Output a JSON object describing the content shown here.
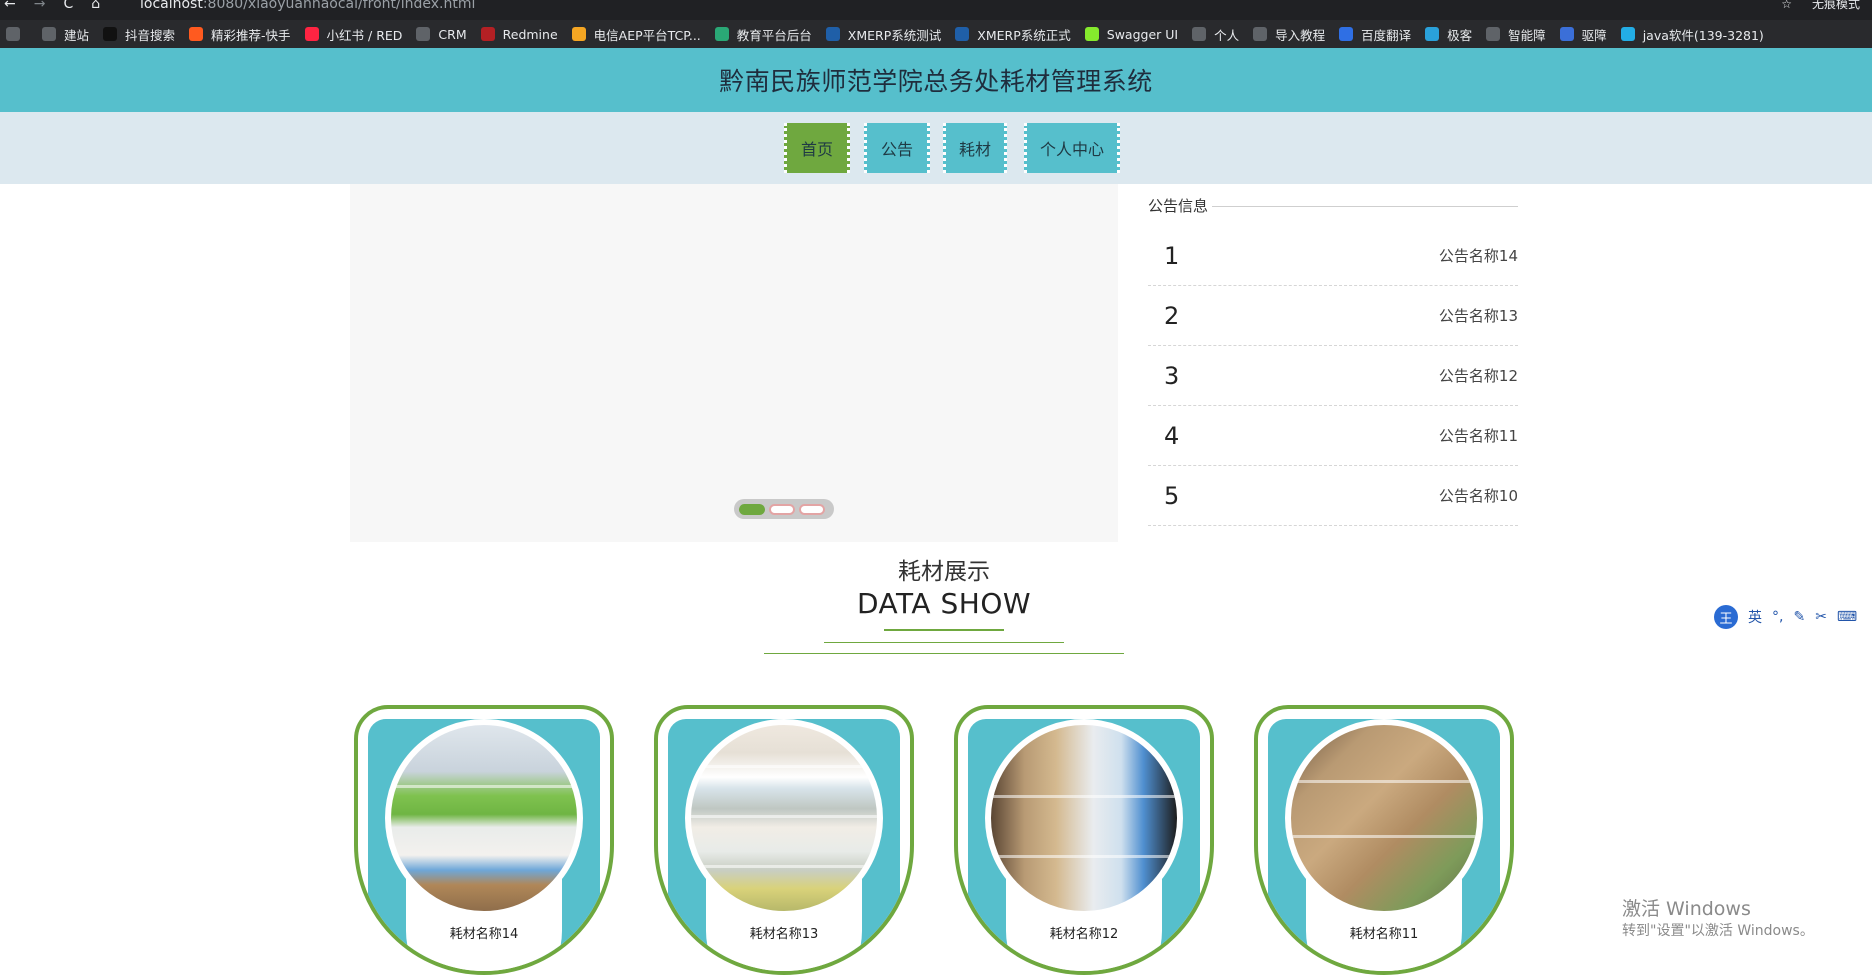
{
  "browser": {
    "url_host": "localhost",
    "url_rest": ":8080/xiaoyuanhaocai/front/index.html",
    "nav_back": "←",
    "nav_forward": "→",
    "nav_reload": "C",
    "nav_home": "⌂",
    "star": "☆",
    "incognito_label": "无痕模式",
    "bookmarks": [
      {
        "label": "",
        "icon": "grid-icon",
        "color": "#5f6368"
      },
      {
        "label": "建站",
        "icon": "chrome-icon",
        "color": "#5f6368"
      },
      {
        "label": "抖音搜索",
        "icon": "tiktok-icon",
        "color": "#111111"
      },
      {
        "label": "精彩推荐-快手",
        "icon": "kuaishou-icon",
        "color": "#ff5a1f"
      },
      {
        "label": "小红书 / RED",
        "icon": "red-icon",
        "color": "#ff2442"
      },
      {
        "label": "CRM",
        "icon": "globe-icon",
        "color": "#5f6368"
      },
      {
        "label": "Redmine",
        "icon": "redmine-icon",
        "color": "#b32024"
      },
      {
        "label": "电信AEP平台TCP...",
        "icon": "aep-icon",
        "color": "#f5a623"
      },
      {
        "label": "教育平台后台",
        "icon": "edu-icon",
        "color": "#2aa876"
      },
      {
        "label": "XMERP系统测试",
        "icon": "xmerp-icon",
        "color": "#1f5fa8"
      },
      {
        "label": "XMERP系统正式",
        "icon": "xmerp-icon",
        "color": "#1f5fa8"
      },
      {
        "label": "Swagger UI",
        "icon": "swagger-icon",
        "color": "#85ea2d"
      },
      {
        "label": "个人",
        "icon": "globe-icon",
        "color": "#5f6368"
      },
      {
        "label": "导入教程",
        "icon": "globe-icon",
        "color": "#5f6368"
      },
      {
        "label": "百度翻译",
        "icon": "translate-icon",
        "color": "#2f6fe4"
      },
      {
        "label": "极客",
        "icon": "telegram-icon",
        "color": "#2aa1da"
      },
      {
        "label": "智能障",
        "icon": "globe-icon",
        "color": "#5f6368"
      },
      {
        "label": "驱障",
        "icon": "shield-icon",
        "color": "#3b6fd8"
      },
      {
        "label": "java软件(139-3281)",
        "icon": "bilibili-icon",
        "color": "#23ade5"
      }
    ]
  },
  "site": {
    "title": "黔南民族师范学院总务处耗材管理系统",
    "nav": [
      {
        "label": "首页",
        "active": true
      },
      {
        "label": "公告",
        "active": false
      },
      {
        "label": "耗材",
        "active": false
      },
      {
        "label": "个人中心",
        "active": false
      }
    ]
  },
  "notice": {
    "heading": "公告信息",
    "items": [
      {
        "num": "1",
        "name": "公告名称14"
      },
      {
        "num": "2",
        "name": "公告名称13"
      },
      {
        "num": "3",
        "name": "公告名称12"
      },
      {
        "num": "4",
        "name": "公告名称11"
      },
      {
        "num": "5",
        "name": "公告名称10"
      }
    ]
  },
  "carousel": {
    "active_index": 0,
    "count": 3
  },
  "section": {
    "title_cn": "耗材展示",
    "title_en": "DATA SHOW"
  },
  "products": [
    {
      "name": "耗材名称14"
    },
    {
      "name": "耗材名称13"
    },
    {
      "name": "耗材名称12"
    },
    {
      "name": "耗材名称11"
    }
  ],
  "ime": {
    "lang": "英",
    "logo": "王"
  },
  "watermark": {
    "line1": "激活 Windows",
    "line2": "转到\"设置\"以激活 Windows。"
  },
  "colors": {
    "header_bg": "#56bfcc",
    "nav_active": "#6fa83f",
    "accent_green": "#6fa83f"
  }
}
